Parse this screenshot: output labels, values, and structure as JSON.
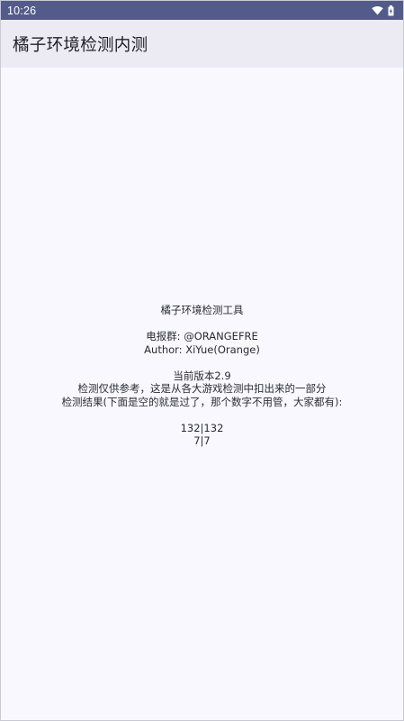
{
  "status_bar": {
    "time": "10:26",
    "icons": [
      "wifi-icon",
      "battery-icon"
    ]
  },
  "app_bar": {
    "title": "橘子环境检测内测"
  },
  "content": {
    "tool_name": "橘子环境检测工具",
    "group": "电报群: @ORANGEFRE",
    "author": "Author: XiYue(Orange)",
    "version": "当前版本2.9",
    "disclaimer": "检测仅供参考，这是从各大游戏检测中扣出来的一部分",
    "result_label": "检测结果(下面是空的就是过了，那个数字不用管，大家都有):",
    "count_1": "132|132",
    "count_2": "7|7"
  },
  "colors": {
    "status_bar": "#535b8a",
    "app_bar": "#eceaf3",
    "background": "#f9f8ff",
    "text": "#2b2b33"
  }
}
